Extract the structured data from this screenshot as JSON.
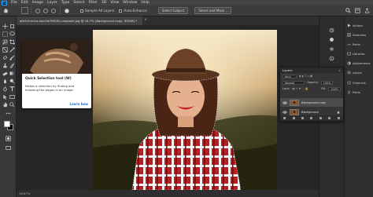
{
  "menubar": {
    "logo": "Ps",
    "items": [
      "File",
      "Edit",
      "Image",
      "Layer",
      "Type",
      "Select",
      "Filter",
      "3D",
      "View",
      "Window",
      "Help"
    ]
  },
  "options": {
    "sample_all_layers": "Sample All Layers",
    "auto_enhance": "Auto-Enhance",
    "select_subject": "Select Subject",
    "select_and_mask": "Select and Mask..."
  },
  "document": {
    "tab_title": "allef-vinicius-kqcOIo7MGFA-unsplash.jpg @ 16.7% (Background copy, RGB/8) *",
    "close": "×",
    "status": "16.67%"
  },
  "tooltip": {
    "title": "Quick Selection tool (W)",
    "text": "Makes a selection by finding and following the edges in an image",
    "link": "Learn how"
  },
  "mini_dock": {
    "items": [
      "Actions",
      "Swatches",
      "Paths",
      "Libraries",
      "Adjustments",
      "Layers",
      "Channels",
      "Paths"
    ]
  },
  "layers_panel": {
    "title": "Layers",
    "close": "×",
    "kind": "Kind",
    "blend": "Normal",
    "opacity_label": "Opacity:",
    "opacity": "100%",
    "lock_label": "Lock:",
    "fill_label": "Fill:",
    "fill": "100%",
    "layers": [
      "Background copy",
      "Background"
    ]
  },
  "colors": {
    "accent": "#1473e6",
    "panel": "#353535"
  }
}
